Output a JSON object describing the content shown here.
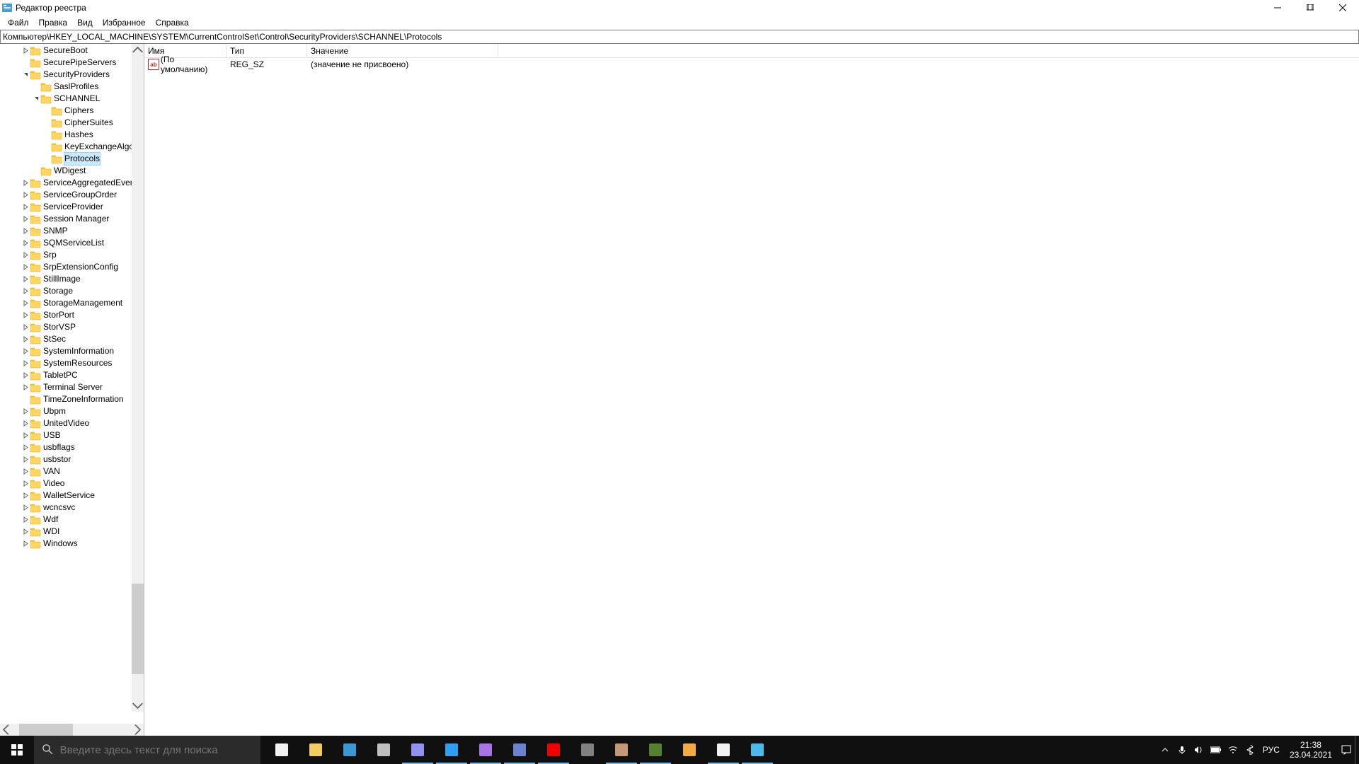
{
  "window": {
    "title": "Редактор реестра"
  },
  "menu": {
    "file": "Файл",
    "edit": "Правка",
    "view": "Вид",
    "favorites": "Избранное",
    "help": "Справка"
  },
  "address": "Компьютер\\HKEY_LOCAL_MACHINE\\SYSTEM\\CurrentControlSet\\Control\\SecurityProviders\\SCHANNEL\\Protocols",
  "tree": {
    "items": [
      {
        "indent": 2,
        "exp": "closed",
        "label": "SecureBoot"
      },
      {
        "indent": 2,
        "exp": "none",
        "label": "SecurePipeServers"
      },
      {
        "indent": 2,
        "exp": "open",
        "label": "SecurityProviders"
      },
      {
        "indent": 3,
        "exp": "none",
        "label": "SaslProfiles"
      },
      {
        "indent": 3,
        "exp": "open",
        "label": "SCHANNEL"
      },
      {
        "indent": 4,
        "exp": "none",
        "label": "Ciphers"
      },
      {
        "indent": 4,
        "exp": "none",
        "label": "CipherSuites"
      },
      {
        "indent": 4,
        "exp": "none",
        "label": "Hashes"
      },
      {
        "indent": 4,
        "exp": "none",
        "label": "KeyExchangeAlgo"
      },
      {
        "indent": 4,
        "exp": "none",
        "label": "Protocols",
        "selected": true
      },
      {
        "indent": 3,
        "exp": "none",
        "label": "WDigest"
      },
      {
        "indent": 2,
        "exp": "closed",
        "label": "ServiceAggregatedEven"
      },
      {
        "indent": 2,
        "exp": "closed",
        "label": "ServiceGroupOrder"
      },
      {
        "indent": 2,
        "exp": "closed",
        "label": "ServiceProvider"
      },
      {
        "indent": 2,
        "exp": "closed",
        "label": "Session Manager"
      },
      {
        "indent": 2,
        "exp": "closed",
        "label": "SNMP"
      },
      {
        "indent": 2,
        "exp": "closed",
        "label": "SQMServiceList"
      },
      {
        "indent": 2,
        "exp": "closed",
        "label": "Srp"
      },
      {
        "indent": 2,
        "exp": "closed",
        "label": "SrpExtensionConfig"
      },
      {
        "indent": 2,
        "exp": "closed",
        "label": "StillImage"
      },
      {
        "indent": 2,
        "exp": "closed",
        "label": "Storage"
      },
      {
        "indent": 2,
        "exp": "closed",
        "label": "StorageManagement"
      },
      {
        "indent": 2,
        "exp": "closed",
        "label": "StorPort"
      },
      {
        "indent": 2,
        "exp": "closed",
        "label": "StorVSP"
      },
      {
        "indent": 2,
        "exp": "closed",
        "label": "StSec"
      },
      {
        "indent": 2,
        "exp": "closed",
        "label": "SystemInformation"
      },
      {
        "indent": 2,
        "exp": "closed",
        "label": "SystemResources"
      },
      {
        "indent": 2,
        "exp": "closed",
        "label": "TabletPC"
      },
      {
        "indent": 2,
        "exp": "closed",
        "label": "Terminal Server"
      },
      {
        "indent": 2,
        "exp": "none",
        "label": "TimeZoneInformation"
      },
      {
        "indent": 2,
        "exp": "closed",
        "label": "Ubpm"
      },
      {
        "indent": 2,
        "exp": "closed",
        "label": "UnitedVideo"
      },
      {
        "indent": 2,
        "exp": "closed",
        "label": "USB"
      },
      {
        "indent": 2,
        "exp": "closed",
        "label": "usbflags"
      },
      {
        "indent": 2,
        "exp": "closed",
        "label": "usbstor"
      },
      {
        "indent": 2,
        "exp": "closed",
        "label": "VAN"
      },
      {
        "indent": 2,
        "exp": "closed",
        "label": "Video"
      },
      {
        "indent": 2,
        "exp": "closed",
        "label": "WalletService"
      },
      {
        "indent": 2,
        "exp": "closed",
        "label": "wcncsvc"
      },
      {
        "indent": 2,
        "exp": "closed",
        "label": "Wdf"
      },
      {
        "indent": 2,
        "exp": "closed",
        "label": "WDI"
      },
      {
        "indent": 2,
        "exp": "closed",
        "label": "Windows"
      }
    ]
  },
  "list": {
    "columns": {
      "name": "Имя",
      "type": "Тип",
      "value": "Значение"
    },
    "col_widths": {
      "name": 116,
      "type": 114,
      "value": 270
    },
    "rows": [
      {
        "name": "(По умолчанию)",
        "type": "REG_SZ",
        "value": "(значение не присвоено)"
      }
    ]
  },
  "taskbar": {
    "search_placeholder": "Введите здесь текст для поиска",
    "apps": [
      {
        "name": "task-view-icon",
        "color": "#ffffff"
      },
      {
        "name": "file-explorer-icon",
        "color": "#ffd666"
      },
      {
        "name": "task-manager-icon",
        "color": "#3fa0e0"
      },
      {
        "name": "video-editor-icon",
        "color": "#c8c8c8"
      },
      {
        "name": "after-effects-icon",
        "color": "#9999ff",
        "active": true
      },
      {
        "name": "photoshop-icon",
        "color": "#31a8ff",
        "active": true
      },
      {
        "name": "visual-studio-icon",
        "color": "#b179f1",
        "active": true
      },
      {
        "name": "discord-icon",
        "color": "#7289da",
        "active": true
      },
      {
        "name": "yandex-browser-icon",
        "color": "#ff0000",
        "active": true
      },
      {
        "name": "app-n-icon",
        "color": "#888888"
      },
      {
        "name": "app-pic-icon",
        "color": "#d0a080",
        "active": true
      },
      {
        "name": "minecraft-icon",
        "color": "#5b8731",
        "active": true
      },
      {
        "name": "memu-icon",
        "color": "#ffb347"
      },
      {
        "name": "settings-icon",
        "color": "#ffffff",
        "active": true
      },
      {
        "name": "regedit-icon",
        "color": "#4fc3f7",
        "active": true
      }
    ],
    "tray": {
      "lang": "РУС",
      "time": "21:38",
      "date": "23.04.2021"
    }
  }
}
